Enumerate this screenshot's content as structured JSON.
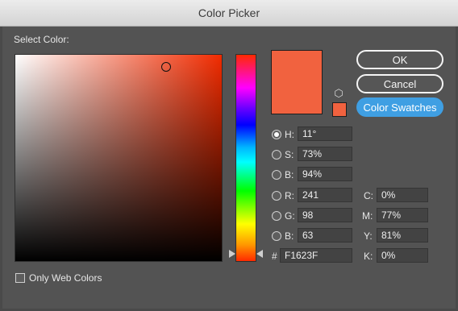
{
  "window": {
    "title": "Color Picker"
  },
  "select_label": "Select Color:",
  "colors": {
    "current": "#F1623F",
    "hue_base": "#F12B00",
    "accent": "#3F9FE3"
  },
  "buttons": {
    "ok": "OK",
    "cancel": "Cancel",
    "swatches": "Color Swatches"
  },
  "fields": {
    "h": {
      "label": "H:",
      "value": "11°",
      "selected": true
    },
    "s": {
      "label": "S:",
      "value": "73%"
    },
    "b": {
      "label": "B:",
      "value": "94%"
    },
    "r": {
      "label": "R:",
      "value": "241"
    },
    "g": {
      "label": "G:",
      "value": "98"
    },
    "b2": {
      "label": "B:",
      "value": "63"
    },
    "hex": {
      "label": "#",
      "value": "F1623F"
    },
    "c": {
      "label": "C:",
      "value": "0%"
    },
    "m": {
      "label": "M:",
      "value": "77%"
    },
    "y": {
      "label": "Y:",
      "value": "81%"
    },
    "k": {
      "label": "K:",
      "value": "0%"
    }
  },
  "web_colors": {
    "label": "Only Web Colors",
    "checked": false
  },
  "icons": {
    "gamut_warning": "cube-icon"
  }
}
